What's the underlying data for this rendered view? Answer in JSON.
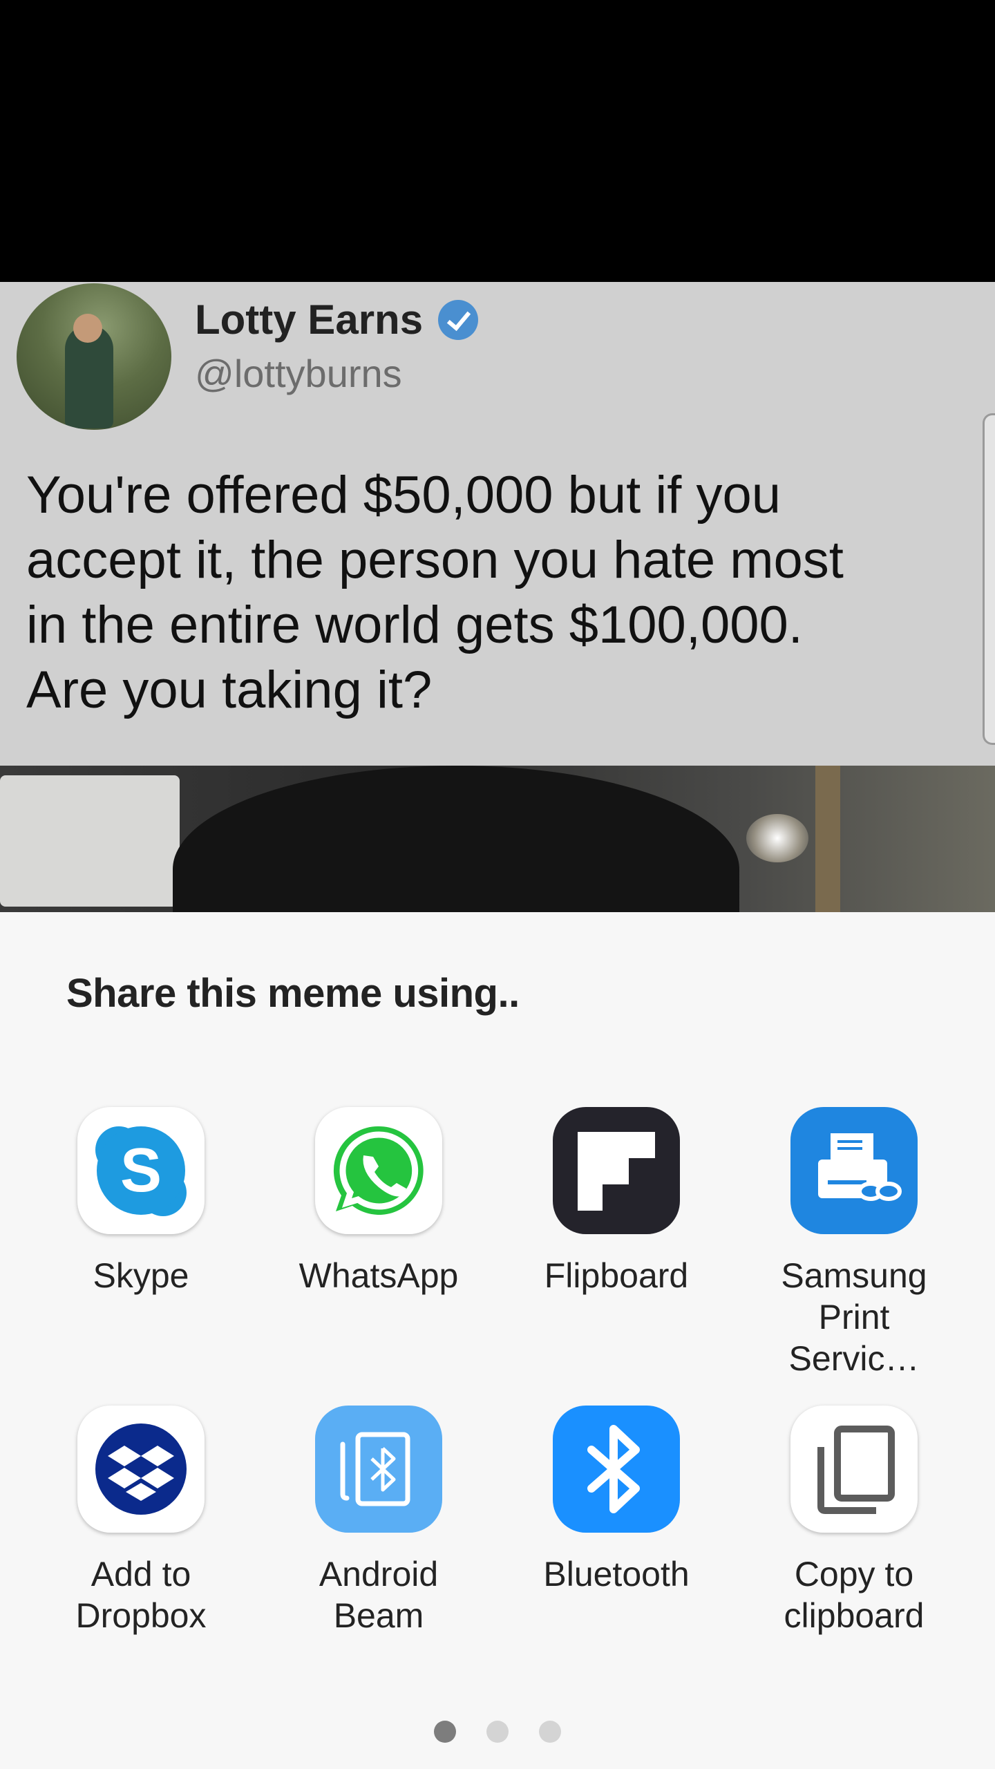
{
  "tweet": {
    "name": "Lotty Earns",
    "handle": "@lottyburns",
    "text_lines": [
      "You're offered $50,000 but if you",
      "accept it, the person you hate most",
      "in the entire world gets $100,000.",
      "Are you taking it?"
    ]
  },
  "share": {
    "title": "Share this meme using..",
    "apps": [
      {
        "label_lines": [
          "Skype"
        ],
        "icon": "skype-icon",
        "color": "#1e9be0"
      },
      {
        "label_lines": [
          "WhatsApp"
        ],
        "icon": "whatsapp-icon",
        "color": "#25c43f"
      },
      {
        "label_lines": [
          "Flipboard"
        ],
        "icon": "flipboard-icon",
        "color": "#24232b"
      },
      {
        "label_lines": [
          "Samsung",
          "Print Servic…"
        ],
        "icon": "printer-icon",
        "color": "#1f86e0"
      },
      {
        "label_lines": [
          "Add to",
          "Dropbox"
        ],
        "icon": "dropbox-icon",
        "color": "#0b2a8c"
      },
      {
        "label_lines": [
          "Android",
          "Beam"
        ],
        "icon": "android-beam-icon",
        "color": "#5aaef4"
      },
      {
        "label_lines": [
          "Bluetooth"
        ],
        "icon": "bluetooth-icon",
        "color": "#1a90ff"
      },
      {
        "label_lines": [
          "Copy to",
          "clipboard"
        ],
        "icon": "clipboard-icon",
        "color": "#5c5c5c"
      }
    ],
    "pages": 3,
    "active_page": 1
  }
}
